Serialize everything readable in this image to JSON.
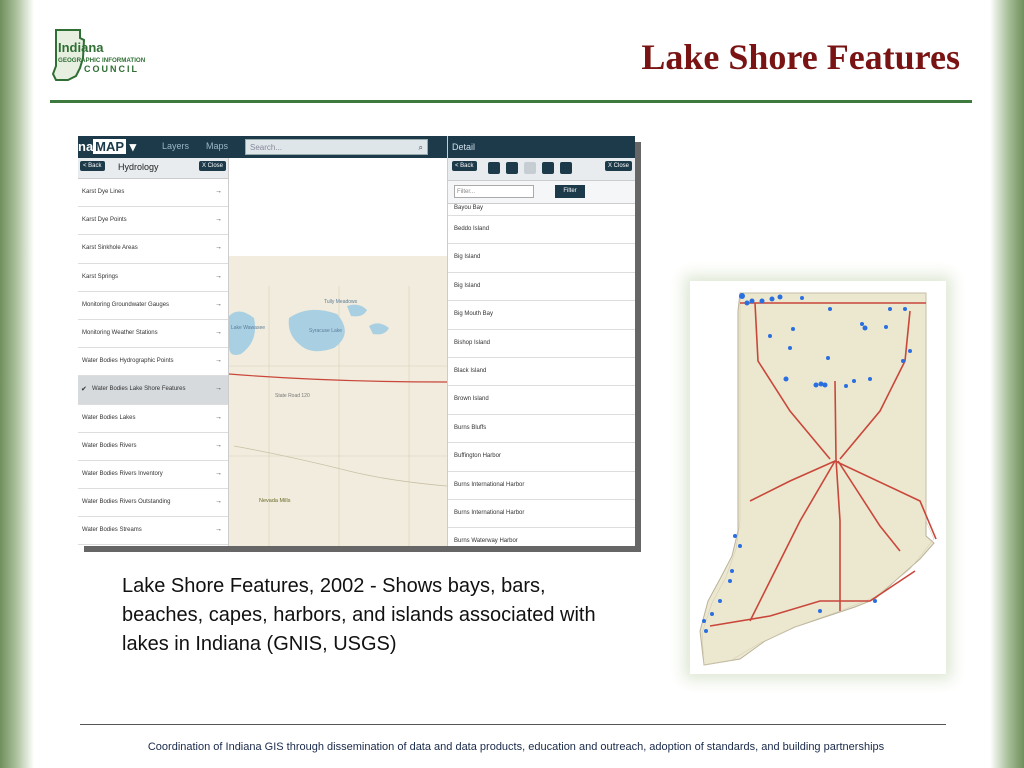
{
  "slide": {
    "title": "Lake Shore Features",
    "caption": "Lake Shore Features, 2002 - Shows bays, bars, beaches, capes, harbors, and islands associated with lakes in Indiana (GNIS, USGS)",
    "footer": "Coordination of Indiana GIS through dissemination of data and data products, education and outreach, adoption of standards, and building partnerships"
  },
  "logo": {
    "line1": "Indiana",
    "line2": "GEOGRAPHIC INFORMATION",
    "line3": "COUNCIL"
  },
  "app": {
    "brand_prefix": "na",
    "brand": "MAP",
    "tabs": {
      "layers": "Layers",
      "maps": "Maps",
      "detail": "Detail"
    },
    "search_placeholder": "Search...",
    "left_panel": {
      "back": "< Back",
      "title": "Hydrology",
      "close": "X Close",
      "layers": [
        {
          "label": "Karst Dye Lines",
          "selected": false
        },
        {
          "label": "Karst Dye Points",
          "selected": false
        },
        {
          "label": "Karst Sinkhole Areas",
          "selected": false
        },
        {
          "label": "Karst Springs",
          "selected": false
        },
        {
          "label": "Monitoring Groundwater Gauges",
          "selected": false
        },
        {
          "label": "Monitoring Weather Stations",
          "selected": false
        },
        {
          "label": "Water Bodies Hydrographic Points",
          "selected": false
        },
        {
          "label": "Water Bodies Lake Shore Features",
          "selected": true
        },
        {
          "label": "Water Bodies Lakes",
          "selected": false
        },
        {
          "label": "Water Bodies Rivers",
          "selected": false
        },
        {
          "label": "Water Bodies Rivers Inventory",
          "selected": false
        },
        {
          "label": "Water Bodies Rivers Outstanding",
          "selected": false
        },
        {
          "label": "Water Bodies Streams",
          "selected": false
        }
      ]
    },
    "right_panel": {
      "back": "< Back",
      "close": "X Close",
      "filter_placeholder": "Filter...",
      "filter_button": "Filter",
      "partial_row": "Bayou Bay",
      "rows": [
        "Beddo Island",
        "Big Island",
        "Big Island",
        "Big Mouth Bay",
        "Bishop Island",
        "Black Island",
        "Brown Island",
        "Burns Bluffs",
        "Buffington Harbor",
        "Burns International Harbor",
        "Burns International Harbor",
        "Burns Waterway Harbor"
      ]
    },
    "map_labels": {
      "lake1": "Tully Meadows",
      "lake2": "Lake Wawasee",
      "lake3": "Syracuse Lake",
      "road": "State Road 120",
      "town": "Nevada Mills"
    }
  },
  "colors": {
    "title": "#7a1414",
    "accent_rule": "#3e7a3e",
    "app_header": "#1d3a4a",
    "water": "#a9cfe3",
    "points": "#2a6fe0",
    "roads": "#c9473a"
  }
}
